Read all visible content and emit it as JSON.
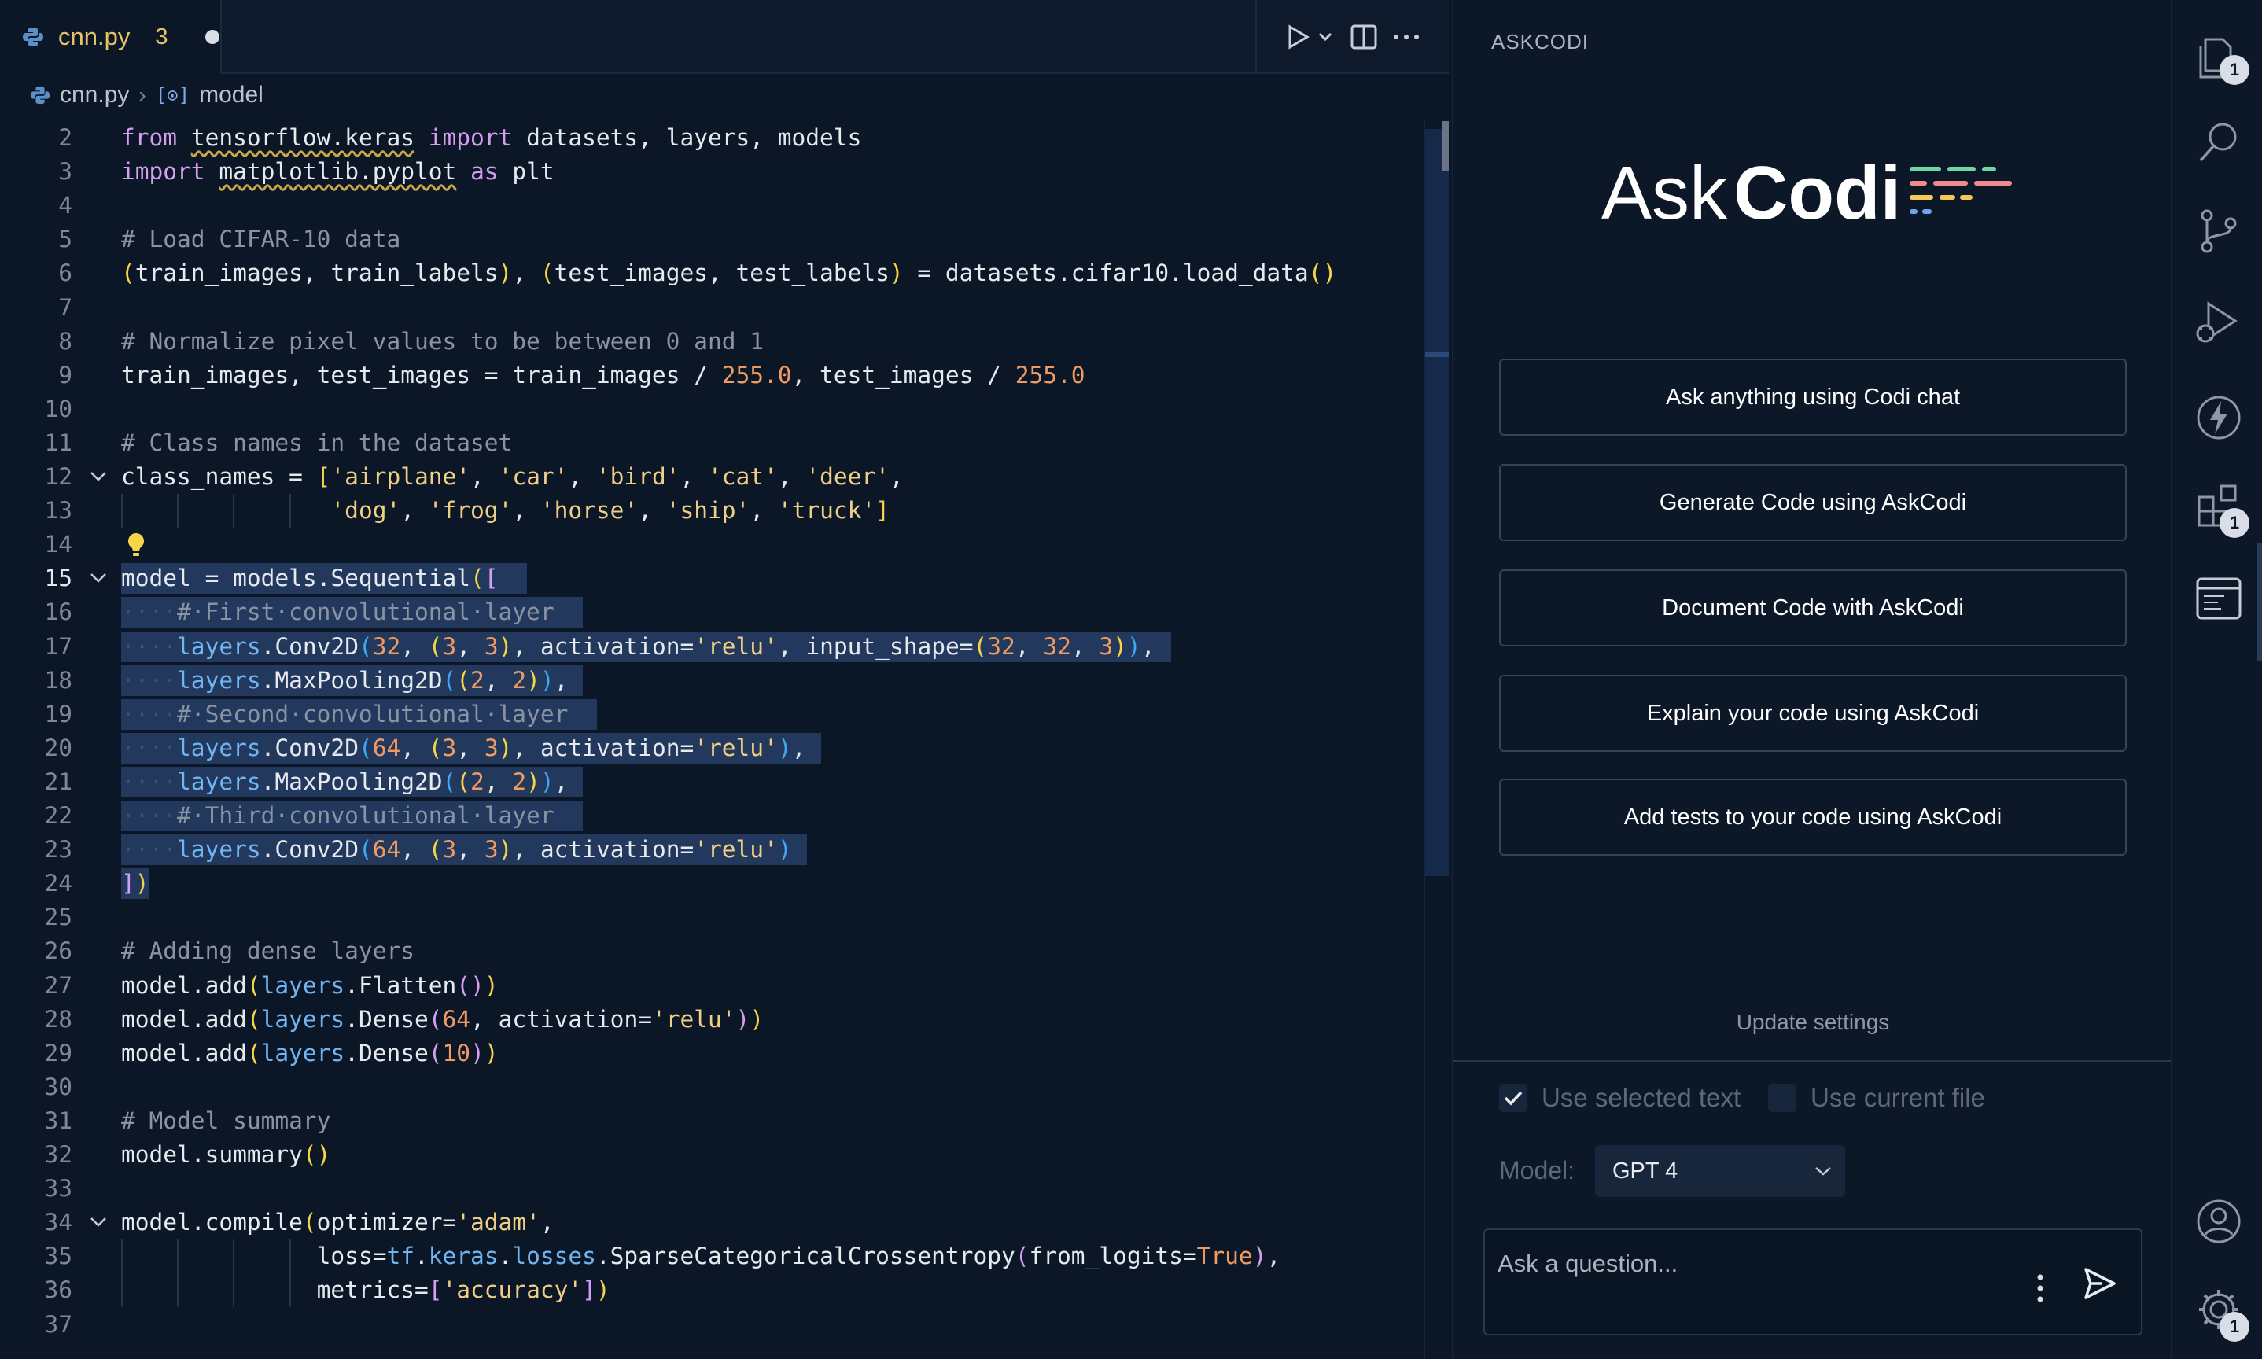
{
  "tab": {
    "filename": "cnn.py",
    "problems": "3"
  },
  "breadcrumb": {
    "file": "cnn.py",
    "symbol": "model"
  },
  "code_lines": [
    {
      "n": "2",
      "html": "<span class=\"kw\">from</span> <span class=\"sq\">tensorflow.keras</span> <span class=\"kw\">import</span> datasets, layers, models"
    },
    {
      "n": "3",
      "html": "<span class=\"kw\">import</span> <span class=\"sq\">matplotlib.pyplot</span> <span class=\"kw\">as</span> plt"
    },
    {
      "n": "4",
      "html": ""
    },
    {
      "n": "5",
      "html": "<span class=\"cm\"># Load CIFAR-10 data</span>"
    },
    {
      "n": "6",
      "html": "<span class=\"br\">(</span>train_images, train_labels<span class=\"br\">)</span>, <span class=\"br\">(</span>test_images, test_labels<span class=\"br\">)</span> = datasets.cifar10.load_data<span class=\"br\">()</span>"
    },
    {
      "n": "7",
      "html": ""
    },
    {
      "n": "8",
      "html": "<span class=\"cm\"># Normalize pixel values to be between 0 and 1</span>"
    },
    {
      "n": "9",
      "html": "train_images, test_images = train_images / <span class=\"num\">255.0</span>, test_images / <span class=\"num\">255.0</span>"
    },
    {
      "n": "10",
      "html": ""
    },
    {
      "n": "11",
      "html": "<span class=\"cm\"># Class names in the dataset</span>"
    },
    {
      "n": "12",
      "fold": true,
      "html": "class_names = <span class=\"br\">[</span><span class=\"str\">'airplane'</span>, <span class=\"str\">'car'</span>, <span class=\"str\">'bird'</span>, <span class=\"str\">'cat'</span>, <span class=\"str\">'deer'</span>,"
    },
    {
      "n": "13",
      "guides": [
        0,
        4,
        8,
        12
      ],
      "html": "               <span class=\"str\">'dog'</span>, <span class=\"str\">'frog'</span>, <span class=\"str\">'horse'</span>, <span class=\"str\">'ship'</span>, <span class=\"str\">'truck'</span><span class=\"br\">]</span>"
    },
    {
      "n": "14",
      "html": ""
    },
    {
      "n": "15",
      "fold": true,
      "current": true,
      "sel": 29,
      "html": "model = models.Sequential<span class=\"br\">(</span><span class=\"br2\">[</span>"
    },
    {
      "n": "16",
      "sel": 33,
      "html": "<span class=\"ws\">····</span><span class=\"cm\">#·First·convolutional·layer</span>"
    },
    {
      "n": "17",
      "sel": 75,
      "html": "<span class=\"ws\">····</span><span class=\"cls\">layers</span>.Conv2D<span class=\"br3\">(</span><span class=\"num\">32</span>, <span class=\"br\">(</span><span class=\"num\">3</span>, <span class=\"num\">3</span><span class=\"br\">)</span>, activation=<span class=\"str\">'relu'</span>, input_shape=<span class=\"br\">(</span><span class=\"num\">32</span>, <span class=\"num\">32</span>, <span class=\"num\">3</span><span class=\"br\">)</span><span class=\"br3\">)</span>,"
    },
    {
      "n": "18",
      "sel": 33,
      "html": "<span class=\"ws\">····</span><span class=\"cls\">layers</span>.MaxPooling2D<span class=\"br3\">(</span><span class=\"br\">(</span><span class=\"num\">2</span>, <span class=\"num\">2</span><span class=\"br\">)</span><span class=\"br3\">)</span>,"
    },
    {
      "n": "19",
      "sel": 34,
      "html": "<span class=\"ws\">····</span><span class=\"cm\">#·Second·convolutional·layer</span>"
    },
    {
      "n": "20",
      "sel": 50,
      "html": "<span class=\"ws\">····</span><span class=\"cls\">layers</span>.Conv2D<span class=\"br3\">(</span><span class=\"num\">64</span>, <span class=\"br\">(</span><span class=\"num\">3</span>, <span class=\"num\">3</span><span class=\"br\">)</span>, activation=<span class=\"str\">'relu'</span><span class=\"br3\">)</span>,"
    },
    {
      "n": "21",
      "sel": 33,
      "html": "<span class=\"ws\">····</span><span class=\"cls\">layers</span>.MaxPooling2D<span class=\"br3\">(</span><span class=\"br\">(</span><span class=\"num\">2</span>, <span class=\"num\">2</span><span class=\"br\">)</span><span class=\"br3\">)</span>,"
    },
    {
      "n": "22",
      "sel": 33,
      "html": "<span class=\"ws\">····</span><span class=\"cm\">#·Third·convolutional·layer</span>"
    },
    {
      "n": "23",
      "sel": 49,
      "html": "<span class=\"ws\">····</span><span class=\"cls\">layers</span>.Conv2D<span class=\"br3\">(</span><span class=\"num\">64</span>, <span class=\"br\">(</span><span class=\"num\">3</span>, <span class=\"num\">3</span><span class=\"br\">)</span>, activation=<span class=\"str\">'relu'</span><span class=\"br3\">)</span>"
    },
    {
      "n": "24",
      "sel": 2,
      "html": "<span class=\"br2\">]</span><span class=\"br\">)</span>"
    },
    {
      "n": "25",
      "html": ""
    },
    {
      "n": "26",
      "html": "<span class=\"cm\"># Adding dense layers</span>"
    },
    {
      "n": "27",
      "html": "model.add<span class=\"br\">(</span><span class=\"cls\">layers</span>.Flatten<span class=\"br2\">()</span><span class=\"br\">)</span>"
    },
    {
      "n": "28",
      "html": "model.add<span class=\"br\">(</span><span class=\"cls\">layers</span>.Dense<span class=\"br2\">(</span><span class=\"num\">64</span>, activation=<span class=\"str\">'relu'</span><span class=\"br2\">)</span><span class=\"br\">)</span>"
    },
    {
      "n": "29",
      "html": "model.add<span class=\"br\">(</span><span class=\"cls\">layers</span>.Dense<span class=\"br2\">(</span><span class=\"num\">10</span><span class=\"br2\">)</span><span class=\"br\">)</span>"
    },
    {
      "n": "30",
      "html": ""
    },
    {
      "n": "31",
      "html": "<span class=\"cm\"># Model summary</span>"
    },
    {
      "n": "32",
      "html": "model.summary<span class=\"br\">()</span>"
    },
    {
      "n": "33",
      "html": ""
    },
    {
      "n": "34",
      "fold": true,
      "html": "model.compile<span class=\"br\">(</span>optimizer=<span class=\"str\">'adam'</span>,"
    },
    {
      "n": "35",
      "guides": [
        0,
        4,
        8,
        12
      ],
      "html": "              loss=<span class=\"cls\">tf</span>.<span class=\"cls\">keras</span>.<span class=\"cls\">losses</span>.SparseCategoricalCrossentropy<span class=\"br2\">(</span>from_logits=<span class=\"bool\">True</span><span class=\"br2\">)</span>,"
    },
    {
      "n": "36",
      "guides": [
        0,
        4,
        8,
        12
      ],
      "html": "              metrics=<span class=\"br2\">[</span><span class=\"str\">'accuracy'</span><span class=\"br2\">]</span><span class=\"br\">)</span>"
    },
    {
      "n": "37",
      "html": ""
    }
  ],
  "panel": {
    "title": "ASKCODI",
    "logo": {
      "ask": "Ask",
      "codi": "Codi"
    },
    "actions": [
      "Ask anything using Codi chat",
      "Generate Code using AskCodi",
      "Document Code with AskCodi",
      "Explain your code using AskCodi",
      "Add tests to your code using AskCodi"
    ],
    "update_settings": "Update settings",
    "use_selected_text": "Use selected text",
    "use_current_file": "Use current file",
    "model_label": "Model:",
    "model_value": "GPT 4",
    "ask_placeholder": "Ask a question..."
  },
  "activity_badges": {
    "explorer": "1",
    "extensions": "1",
    "settings": "1"
  },
  "colors": {
    "background": "#0b1727",
    "accent": "#e6c466",
    "selection": "#22385c"
  }
}
